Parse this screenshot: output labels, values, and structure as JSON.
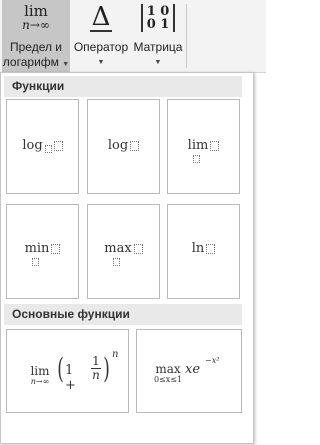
{
  "ribbon": {
    "limit_log": {
      "glyph_top": "lim",
      "glyph_bottom": "n→∞",
      "label_line1": "Предел и",
      "label_line2": "логарифм"
    },
    "operator": {
      "glyph": "Δ",
      "label": "Оператор"
    },
    "matrix": {
      "glyph_row1": "1 0",
      "glyph_row2": "0 1",
      "label": "Матрица"
    },
    "caret": "▼"
  },
  "sections": {
    "functions": "Функции",
    "basic": "Основные функции"
  },
  "functions": [
    {
      "text": "log"
    },
    {
      "text": "log"
    },
    {
      "text": "lim"
    },
    {
      "text": "min"
    },
    {
      "text": "max"
    },
    {
      "text": "ln"
    }
  ],
  "basic": {
    "limit": {
      "lim": "lim",
      "sub": "n→∞",
      "open": "(",
      "one": "1",
      "plus": "+",
      "num": "1",
      "den": "n",
      "close": ")",
      "exp": "n"
    },
    "max": {
      "op": "max",
      "sub": "0≤x≤1",
      "expr": "xe",
      "exp": "−x²"
    }
  }
}
